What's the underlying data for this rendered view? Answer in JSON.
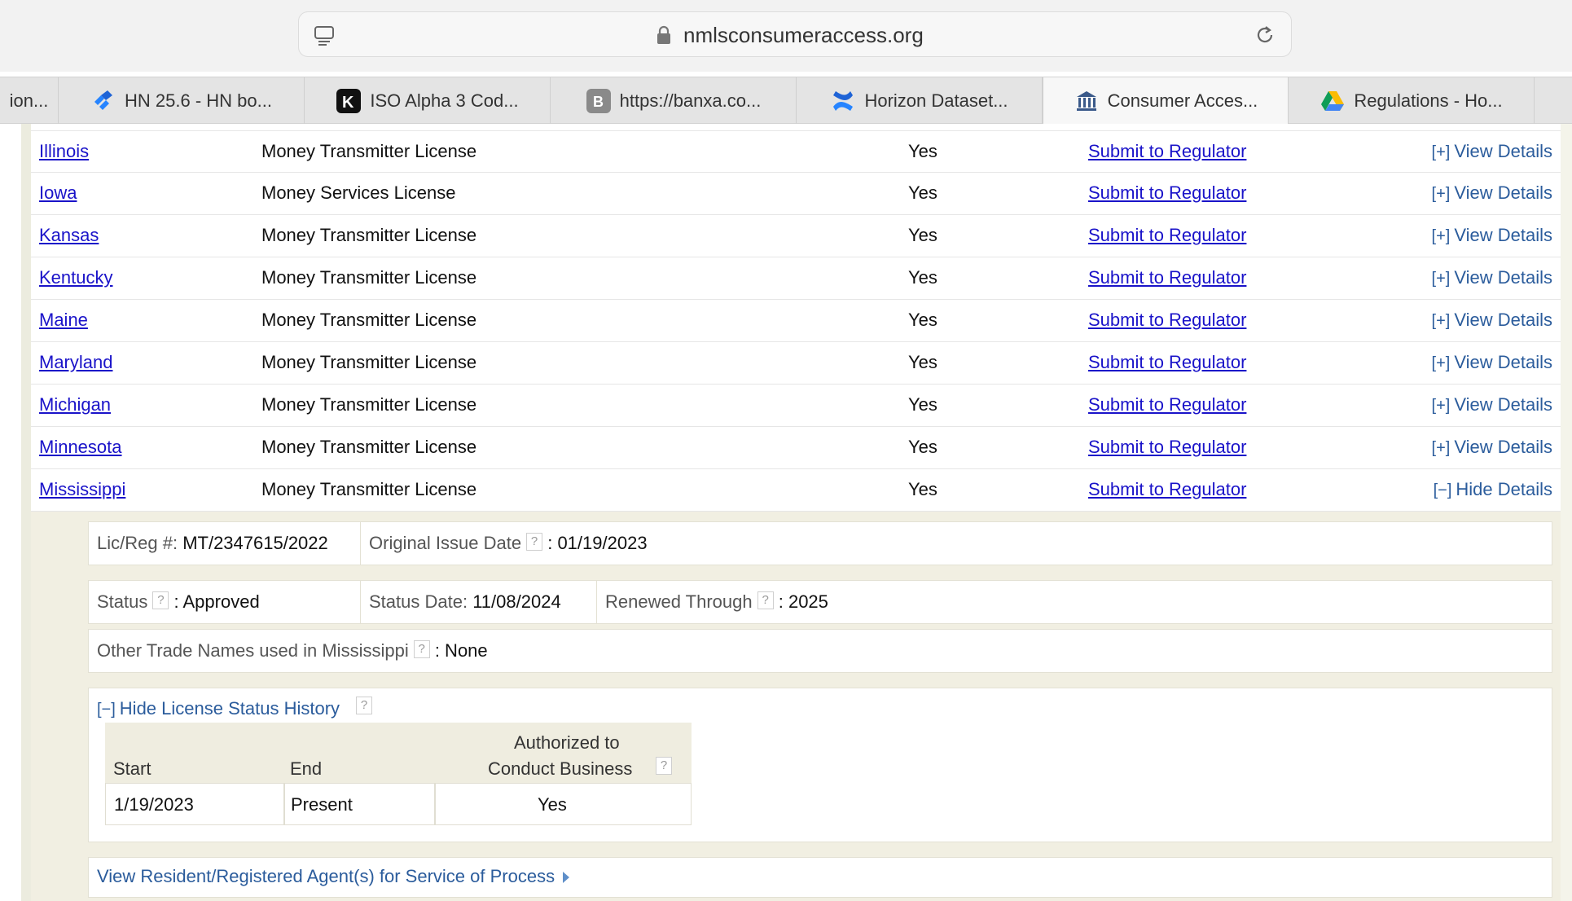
{
  "browser": {
    "url": "nmlsconsumeraccess.org",
    "tabs": [
      {
        "label": "ion...",
        "icon": "none"
      },
      {
        "label": "HN 25.6 - HN bo...",
        "icon": "jira-icon"
      },
      {
        "label": "ISO Alpha 3 Cod...",
        "icon": "k-logo-icon"
      },
      {
        "label": "https://banxa.co...",
        "icon": "b-letter-icon"
      },
      {
        "label": "Horizon Dataset...",
        "icon": "confluence-icon"
      },
      {
        "label": "Consumer Acces...",
        "icon": "bank-icon",
        "active": true
      },
      {
        "label": "Regulations - Ho...",
        "icon": "google-drive-icon"
      }
    ]
  },
  "licenses": [
    {
      "state": "Illinois",
      "type": "Money Transmitter License",
      "authorized": "Yes",
      "submit": "Submit to Regulator",
      "toggle": "[+]",
      "details": "View Details"
    },
    {
      "state": "Iowa",
      "type": "Money Services License",
      "authorized": "Yes",
      "submit": "Submit to Regulator",
      "toggle": "[+]",
      "details": "View Details"
    },
    {
      "state": "Kansas",
      "type": "Money Transmitter License",
      "authorized": "Yes",
      "submit": "Submit to Regulator",
      "toggle": "[+]",
      "details": "View Details"
    },
    {
      "state": "Kentucky",
      "type": "Money Transmitter License",
      "authorized": "Yes",
      "submit": "Submit to Regulator",
      "toggle": "[+]",
      "details": "View Details"
    },
    {
      "state": "Maine",
      "type": "Money Transmitter License",
      "authorized": "Yes",
      "submit": "Submit to Regulator",
      "toggle": "[+]",
      "details": "View Details"
    },
    {
      "state": "Maryland",
      "type": "Money Transmitter License",
      "authorized": "Yes",
      "submit": "Submit to Regulator",
      "toggle": "[+]",
      "details": "View Details"
    },
    {
      "state": "Michigan",
      "type": "Money Transmitter License",
      "authorized": "Yes",
      "submit": "Submit to Regulator",
      "toggle": "[+]",
      "details": "View Details"
    },
    {
      "state": "Minnesota",
      "type": "Money Transmitter License",
      "authorized": "Yes",
      "submit": "Submit to Regulator",
      "toggle": "[+]",
      "details": "View Details"
    },
    {
      "state": "Mississippi",
      "type": "Money Transmitter License",
      "authorized": "Yes",
      "submit": "Submit to Regulator",
      "toggle": "[−]",
      "details": "Hide Details"
    }
  ],
  "details": {
    "lic_reg_label": "Lic/Reg #:",
    "lic_reg_value": "MT/2347615/2022",
    "original_issue_label": "Original Issue Date",
    "original_issue_value": ": 01/19/2023",
    "status_label": "Status",
    "status_value": ": Approved",
    "status_date_label": "Status Date:",
    "status_date_value": "11/08/2024",
    "renewed_label": "Renewed Through",
    "renewed_value": ": 2025",
    "trade_names_label": "Other Trade Names used in Mississippi",
    "trade_names_value": ": None",
    "help_glyph": "?",
    "history_toggle": "[−]",
    "history_label": "Hide License Status History",
    "history": {
      "headers": {
        "start": "Start",
        "end": "End",
        "authorized_line1": "Authorized to",
        "authorized_line2": "Conduct Business"
      },
      "rows": [
        {
          "start": "1/19/2023",
          "end": "Present",
          "authorized": "Yes"
        }
      ]
    },
    "agent_link": "View Resident/Registered Agent(s) for Service of Process"
  }
}
